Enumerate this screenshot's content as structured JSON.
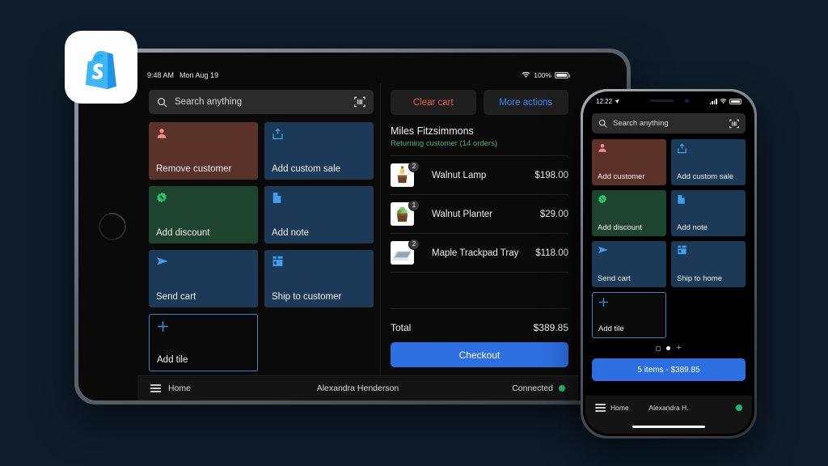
{
  "background_color": "#0e1c2b",
  "app_icon": {
    "name": "shopify-app-icon",
    "brand_color": "#5bc0f8"
  },
  "tablet": {
    "status_bar": {
      "time": "9:48 AM",
      "date": "Mon Aug 19",
      "battery": "100%"
    },
    "search": {
      "placeholder": "Search anything",
      "scan_icon": "barcode-scan-icon"
    },
    "tiles": [
      {
        "label": "Remove customer",
        "color": "red",
        "icon": "customer-icon"
      },
      {
        "label": "Add custom sale",
        "color": "blue",
        "icon": "upload-box-icon"
      },
      {
        "label": "Add discount",
        "color": "green",
        "icon": "discount-badge-icon"
      },
      {
        "label": "Add note",
        "color": "blue",
        "icon": "note-page-icon"
      },
      {
        "label": "Send cart",
        "color": "blue",
        "icon": "send-arrow-icon"
      },
      {
        "label": "Ship to customer",
        "color": "blue",
        "icon": "shipping-store-icon"
      },
      {
        "label": "Add tile",
        "color": "add",
        "icon": "plus-icon"
      }
    ],
    "cart": {
      "clear_label": "Clear cart",
      "more_label": "More actions",
      "customer_name": "Miles Fitzsimmons",
      "customer_status": "Returning customer (14 orders)",
      "items": [
        {
          "name": "Walnut Lamp",
          "price": "$198.00",
          "qty": "2",
          "thumb": "walnut-lamp"
        },
        {
          "name": "Walnut Planter",
          "price": "$29.00",
          "qty": "1",
          "thumb": "walnut-planter"
        },
        {
          "name": "Maple Trackpad Tray",
          "price": "$118.00",
          "qty": "2",
          "thumb": "trackpad-tray"
        }
      ],
      "total_label": "Total",
      "total_value": "$389.85",
      "checkout_label": "Checkout"
    },
    "bottom_bar": {
      "home_label": "Home",
      "staff_name": "Alexandra Henderson",
      "status": "Connected"
    }
  },
  "phone": {
    "status_bar": {
      "time": "12:22"
    },
    "search": {
      "placeholder": "Search anything",
      "scan_icon": "barcode-scan-icon"
    },
    "tiles": [
      {
        "label": "Add customer",
        "color": "red",
        "icon": "customer-icon"
      },
      {
        "label": "Add custom sale",
        "color": "blue",
        "icon": "upload-box-icon"
      },
      {
        "label": "Add discount",
        "color": "green",
        "icon": "discount-badge-icon"
      },
      {
        "label": "Add note",
        "color": "blue",
        "icon": "note-page-icon"
      },
      {
        "label": "Send cart",
        "color": "blue",
        "icon": "send-arrow-icon"
      },
      {
        "label": "Ship to home",
        "color": "blue",
        "icon": "shipping-store-icon"
      },
      {
        "label": "Add tile",
        "color": "add",
        "icon": "plus-icon"
      }
    ],
    "cart_button": "5 items - $389.85",
    "bottom_bar": {
      "home_label": "Home",
      "staff_name": "Alexandra H."
    }
  }
}
